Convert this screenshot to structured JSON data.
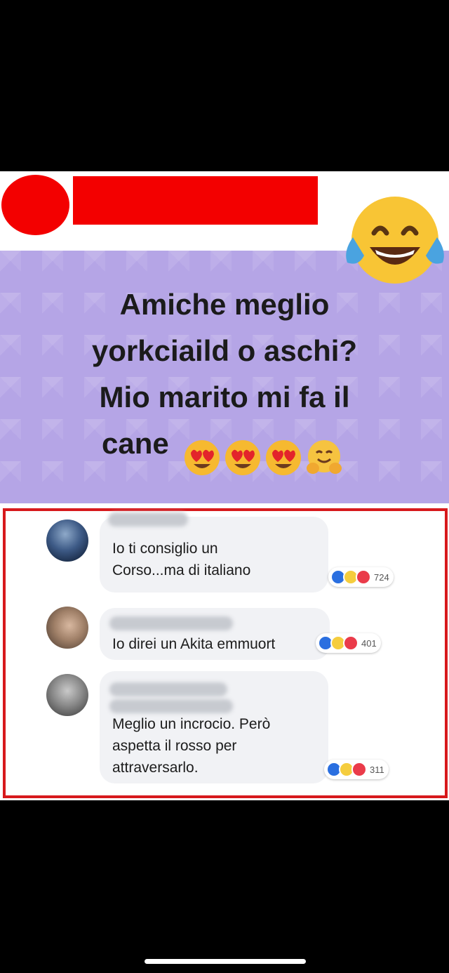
{
  "post": {
    "question_lines": [
      "Amiche meglio",
      "yorkciaild o aschi?",
      "Mio marito mi fa il",
      "cane"
    ],
    "header_emoji": "face-with-tears-of-joy",
    "question_emojis": [
      "heart-eyes",
      "heart-eyes",
      "heart-eyes",
      "hugging-face"
    ]
  },
  "comments": [
    {
      "text": "Io ti consiglio un\nCorso...ma di italiano",
      "reactions": [
        "like",
        "haha",
        "love"
      ],
      "count": "724"
    },
    {
      "text": "Io direi un Akita emmuort",
      "reactions": [
        "like",
        "haha",
        "love"
      ],
      "count": "401"
    },
    {
      "text": "Meglio un incrocio. Però\naspetta il rosso per\nattraversarlo.",
      "reactions": [
        "like",
        "haha",
        "love"
      ],
      "count": "311"
    }
  ]
}
